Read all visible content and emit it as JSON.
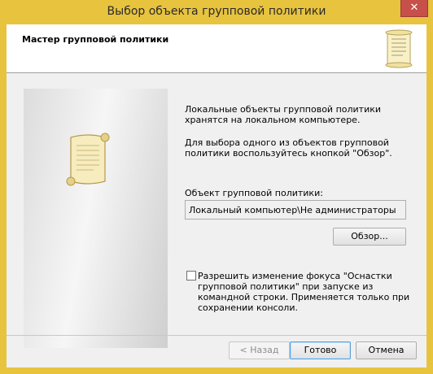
{
  "window": {
    "title": "Выбор объекта групповой политики",
    "close_glyph": "✕"
  },
  "header": {
    "title": "Мастер групповой политики",
    "icon": "scroll-icon"
  },
  "sidebar": {
    "icon": "scroll-icon"
  },
  "content": {
    "paragraph1": "Локальные объекты групповой политики хранятся на локальном компьютере.",
    "paragraph2": "Для выбора одного из объектов групповой политики воспользуйтесь кнопкой \"Обзор\".",
    "gpo_label": "Объект групповой политики:",
    "gpo_value": "Локальный компьютер\\Не администраторы",
    "browse_label": "Обзор...",
    "checkbox_label": "Разрешить изменение фокуса \"Оснастки групповой политики\" при запуске из командной строки. Применяется только при сохранении консоли.",
    "checkbox_checked": false
  },
  "footer": {
    "back_label": "< Назад",
    "finish_label": "Готово",
    "cancel_label": "Отмена"
  },
  "colors": {
    "titlebar": "#e8c33e",
    "close_button": "#c7504a"
  }
}
